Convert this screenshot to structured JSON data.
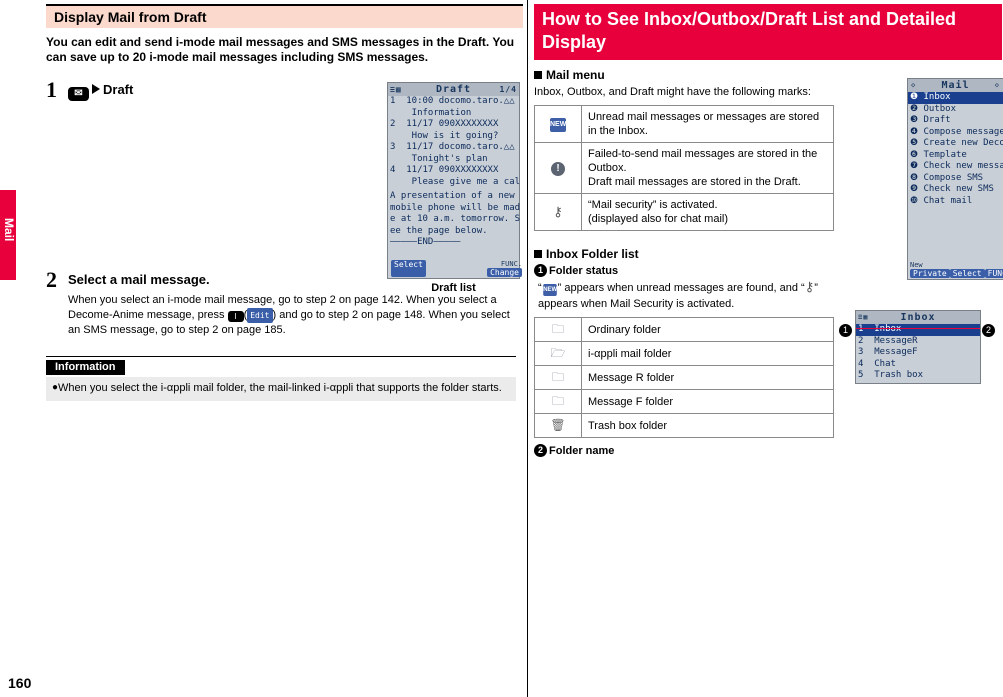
{
  "side_tab": {
    "label": "Mail"
  },
  "page_number": "160",
  "left": {
    "section_title": "Display Mail from Draft",
    "intro": "You can edit and send i-mode mail messages and SMS messages in the Draft. You can save up to 20 i-mode mail messages including SMS messages.",
    "steps": [
      {
        "num": "1",
        "key_icon": "mail-key-icon",
        "arrow": "play-arrow-icon",
        "head": "Draft",
        "body": ""
      },
      {
        "num": "2",
        "head": "Select a mail message.",
        "body": "When you select an i-mode mail message, go to step 2 on page 142. When you select a Decome-Anime message, press l(    ) and go to step 2 on page 148. When you select an SMS message, go to step 2 on page 185.",
        "body_part1": "When you select an i-mode mail message, go to step 2 on page 142. When you select a Decome-Anime message, press ",
        "body_key": "l",
        "body_softkey": "Edit",
        "body_part2": ") and go to step 2 on page 148. When you select an SMS message, go to step 2 on page 185."
      }
    ],
    "information": {
      "title": "Information",
      "items": [
        "When you select the i-αppli mail folder, the mail-linked i-αppli that supports the folder starts."
      ]
    },
    "draft_screen": {
      "title": "Draft",
      "counter": "1/4",
      "status_left": "sort-icon",
      "caption": "Draft list",
      "rows": [
        "1  10:00 docomo.taro.△△",
        "    Information",
        "2  11/17 090XXXXXXXX",
        "    How is it going?",
        "3  11/17 docomo.taro.△△",
        "    Tonight's plan",
        "4  11/17 090XXXXXXXX",
        "    Please give me a cal"
      ],
      "preview": [
        "A presentation of a new",
        "mobile phone will be mad",
        "e at 10 a.m. tomorrow. S",
        "ee the page below.",
        "―――――END―――――"
      ],
      "softkeys": {
        "left": "Select",
        "right_top": "FUNC.",
        "right": "Change"
      }
    }
  },
  "right": {
    "title": "How to See Inbox/Outbox/Draft List and Detailed Display",
    "mail_menu": {
      "heading": "Mail menu",
      "lead": "Inbox, Outbox, and Draft might have the following marks:",
      "rows": [
        {
          "icon": "new-mail-icon",
          "text": "Unread mail messages or messages are stored in the Inbox."
        },
        {
          "icon": "exclamation-icon",
          "text": "Failed-to-send mail messages are stored in the Outbox.\nDraft mail messages are stored in the Draft."
        },
        {
          "icon": "key-lock-icon",
          "text": "“Mail security” is activated.\n(displayed also for chat mail)"
        }
      ],
      "row_texts": [
        "Unread mail messages or messages are stored in the Inbox.",
        "Failed-to-send mail messages are stored in the Outbox.",
        "Draft mail messages are stored in the Draft.",
        "“Mail security” is activated.",
        "(displayed also for chat mail)"
      ]
    },
    "mail_screen": {
      "title": "Mail",
      "items": [
        "Inbox",
        "Outbox",
        "Draft",
        "Compose message",
        "Create new Decome-Anime",
        "Template",
        "Check new messages",
        "Compose SMS",
        "Check new SMS",
        "Chat mail"
      ],
      "softkeys": {
        "left_top": "New",
        "left": "Private",
        "center": "Select",
        "right": "FUNC."
      }
    },
    "inbox_folder": {
      "heading": "Inbox Folder list",
      "item1_label": "Folder status",
      "item1_text_a": "“",
      "item1_text_b": "” appears when unread messages are found, and “",
      "item1_text_c": "” appears when Mail Security is activated.",
      "item2_label": "Folder name",
      "table": [
        {
          "icon": "ordinary-folder-icon",
          "text": "Ordinary folder"
        },
        {
          "icon": "iappli-mail-folder-icon",
          "text": "i-αppli mail folder"
        },
        {
          "icon": "message-r-folder-icon",
          "text": "Message R folder"
        },
        {
          "icon": "message-f-folder-icon",
          "text": "Message F folder"
        },
        {
          "icon": "trash-box-folder-icon",
          "text": "Trash box folder"
        }
      ],
      "marker1": "1",
      "marker2": "2"
    },
    "inbox_screen": {
      "title": "Inbox",
      "rows": [
        "1  Inbox",
        "2  MessageR",
        "3  MessageF",
        "4  Chat",
        "5  Trash box"
      ]
    }
  }
}
